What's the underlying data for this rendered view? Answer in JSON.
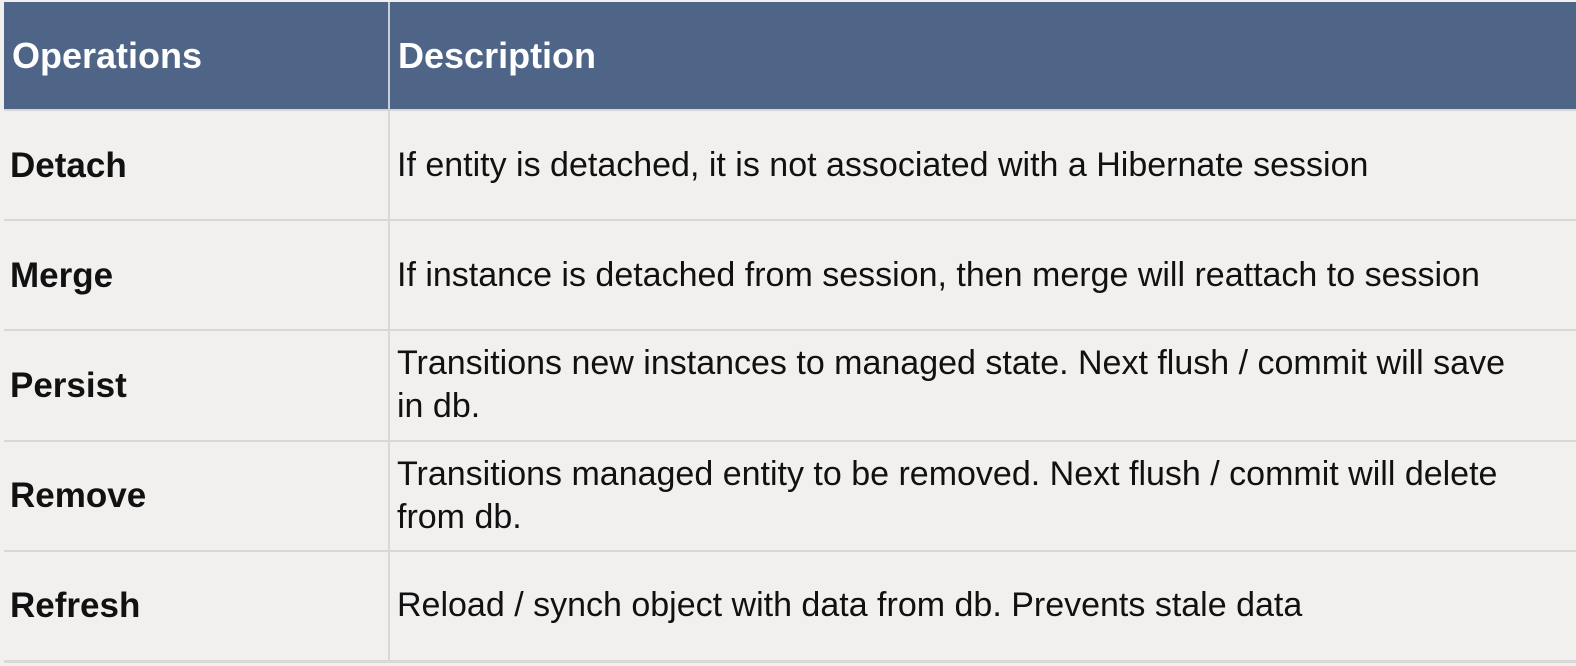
{
  "table": {
    "headers": [
      "Operations",
      "Description"
    ],
    "rows": [
      {
        "operation": "Detach",
        "description": "If entity is detached, it is not associated with a Hibernate session"
      },
      {
        "operation": "Merge",
        "description": "If instance is detached from session, then merge will reattach to session"
      },
      {
        "operation": "Persist",
        "description": "Transitions new instances to managed state. Next flush / commit will save in db."
      },
      {
        "operation": "Remove",
        "description": "Transitions managed entity to be removed. Next flush / commit will delete from db."
      },
      {
        "operation": "Refresh",
        "description": "Reload / synch object with data from db. Prevents stale data"
      }
    ]
  },
  "colors": {
    "header_bg": "#4f6588",
    "header_text": "#ffffff",
    "body_bg": "#f1f0ee",
    "grid": "#d9d8d5"
  }
}
